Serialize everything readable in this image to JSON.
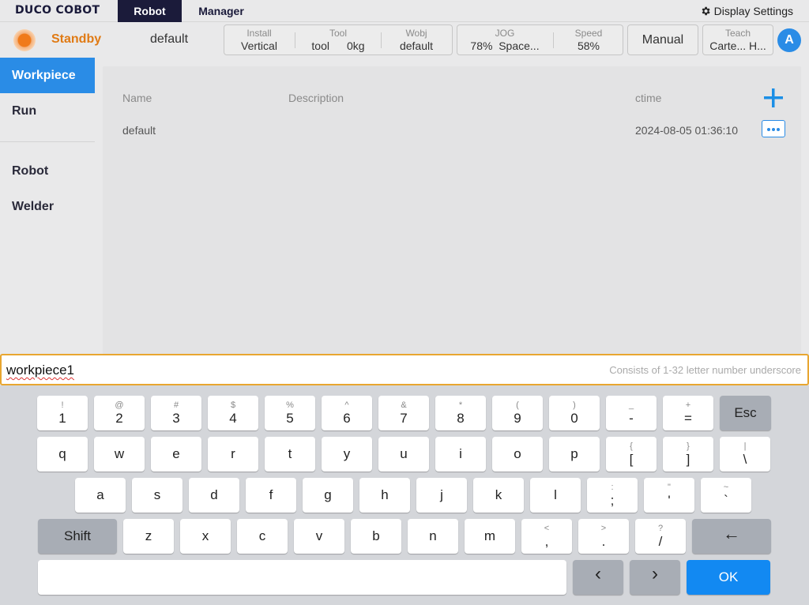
{
  "app": {
    "logo": "DUCO COBOT"
  },
  "tabs": [
    {
      "label": "Robot"
    },
    {
      "label": "Manager"
    }
  ],
  "display_settings": {
    "label": "Display Settings",
    "icon": "gear-icon"
  },
  "status": {
    "state": "Standby",
    "program": "default",
    "install": {
      "label": "Install",
      "value": "Vertical"
    },
    "tool": {
      "label": "Tool",
      "name": "tool",
      "weight": "0kg"
    },
    "wobj": {
      "label": "Wobj",
      "value": "default"
    },
    "jog": {
      "label": "JOG",
      "percent": "78%",
      "mode": "Space..."
    },
    "speed": {
      "label": "Speed",
      "value": "58%"
    },
    "manual": "Manual",
    "teach": {
      "label": "Teach",
      "value": "Carte... H..."
    },
    "user_initial": "A",
    "state_color": "#e07a14"
  },
  "sidebar": {
    "items": [
      {
        "label": "Workpiece"
      },
      {
        "label": "Run"
      },
      {
        "label": "Robot"
      },
      {
        "label": "Welder"
      }
    ]
  },
  "table": {
    "headers": {
      "name": "Name",
      "description": "Description",
      "ctime": "ctime"
    },
    "rows": [
      {
        "name": "default",
        "description": "",
        "ctime": "2024-08-05 01:36:10"
      }
    ]
  },
  "input": {
    "value": "workpiece1",
    "hint": "Consists of 1-32 letter number underscore"
  },
  "keyboard": {
    "row1": [
      {
        "m": "1",
        "s": "!"
      },
      {
        "m": "2",
        "s": "@"
      },
      {
        "m": "3",
        "s": "#"
      },
      {
        "m": "4",
        "s": "$"
      },
      {
        "m": "5",
        "s": "%"
      },
      {
        "m": "6",
        "s": "^"
      },
      {
        "m": "7",
        "s": "&"
      },
      {
        "m": "8",
        "s": "*"
      },
      {
        "m": "9",
        "s": "("
      },
      {
        "m": "0",
        "s": ")"
      },
      {
        "m": "-",
        "s": "_"
      },
      {
        "m": "=",
        "s": "+"
      }
    ],
    "row2": [
      {
        "m": "q"
      },
      {
        "m": "w"
      },
      {
        "m": "e"
      },
      {
        "m": "r"
      },
      {
        "m": "t"
      },
      {
        "m": "y"
      },
      {
        "m": "u"
      },
      {
        "m": "i"
      },
      {
        "m": "o"
      },
      {
        "m": "p"
      },
      {
        "m": "[",
        "s": "{"
      },
      {
        "m": "]",
        "s": "}"
      },
      {
        "m": "\\",
        "s": "|"
      }
    ],
    "row3": [
      {
        "m": "a"
      },
      {
        "m": "s"
      },
      {
        "m": "d"
      },
      {
        "m": "f"
      },
      {
        "m": "g"
      },
      {
        "m": "h"
      },
      {
        "m": "j"
      },
      {
        "m": "k"
      },
      {
        "m": "l"
      },
      {
        "m": ";",
        "s": ":"
      },
      {
        "m": "'",
        "s": "\""
      },
      {
        "m": "`",
        "s": "~"
      }
    ],
    "row4": [
      {
        "m": "z"
      },
      {
        "m": "x"
      },
      {
        "m": "c"
      },
      {
        "m": "v"
      },
      {
        "m": "b"
      },
      {
        "m": "n"
      },
      {
        "m": "m"
      },
      {
        "m": ",",
        "s": "<"
      },
      {
        "m": ".",
        "s": ">"
      },
      {
        "m": "/",
        "s": "?"
      }
    ],
    "esc": "Esc",
    "shift": "Shift",
    "backspace": "←",
    "left": "‹",
    "right": "›",
    "ok": "OK"
  }
}
